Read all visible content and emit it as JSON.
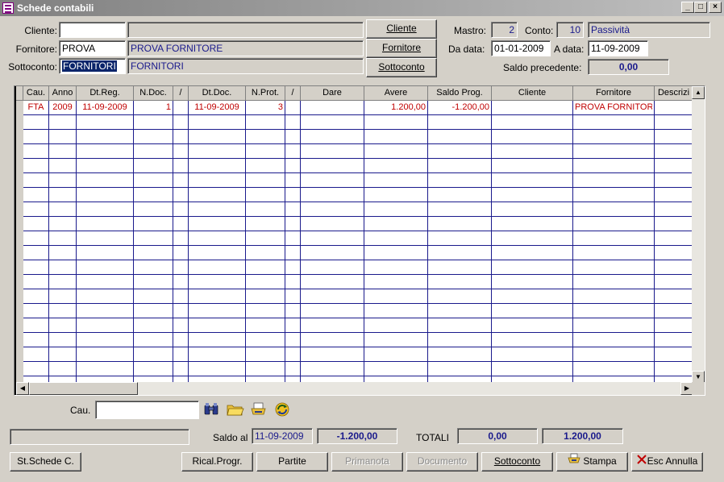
{
  "window": {
    "title": "Schede contabili"
  },
  "header": {
    "cliente_label": "Cliente:",
    "cliente_code": "",
    "cliente_name": "",
    "fornitore_label": "Fornitore:",
    "fornitore_code": "PROVA",
    "fornitore_name": "PROVA FORNITORE",
    "sottoconto_label": "Sottoconto:",
    "sottoconto_code": "FORNITORI",
    "sottoconto_name": "FORNITORI",
    "btn_cliente": "Cliente",
    "btn_fornitore": "Fornitore",
    "btn_sottoconto": "Sottoconto",
    "mastro_label": "Mastro:",
    "mastro_value": "2",
    "conto_label": "Conto:",
    "conto_value": "10",
    "conto_desc": "Passività",
    "da_data_label": "Da data:",
    "da_data_value": "01-01-2009",
    "a_data_label": "A data:",
    "a_data_value": "11-09-2009",
    "saldo_prec_label": "Saldo precedente:",
    "saldo_prec_value": "0,00"
  },
  "grid": {
    "columns": [
      "Cau.",
      "Anno",
      "Dt.Reg.",
      "N.Doc.",
      "/",
      "Dt.Doc.",
      "N.Prot.",
      "/",
      "Dare",
      "Avere",
      "Saldo Prog.",
      "Cliente",
      "Fornitore",
      "Descrizi"
    ],
    "rows": [
      [
        "FTA",
        "2009",
        "11-09-2009",
        "1",
        "",
        "11-09-2009",
        "3",
        "",
        "",
        "1.200,00",
        "-1.200,00",
        "",
        "PROVA FORNITORE",
        ""
      ]
    ]
  },
  "footer": {
    "cau_label": "Cau.",
    "cau_value": "",
    "status_text": "",
    "saldo_al_label": "Saldo al",
    "saldo_al_date": "11-09-2009",
    "saldo_al_value": "-1.200,00",
    "totali_label": "TOTALI",
    "totale_dare": "0,00",
    "totale_avere": "1.200,00",
    "buttons": {
      "st_schede": "St.Schede C.",
      "ricalc": "Rical.Progr.",
      "partite": "Partite",
      "primanota": "Primanota",
      "documento": "Documento",
      "sottoconto": "Sottoconto",
      "stampa": "Stampa",
      "esc": "Esc Annulla"
    }
  },
  "icons": [
    "binoculars-icon",
    "folder-icon",
    "printer-icon",
    "refresh-icon",
    "close-x-icon"
  ],
  "colors": {
    "data_text": "#c00000",
    "grid_lines": "#1a1a8c",
    "field_text": "#1a1a8c"
  }
}
